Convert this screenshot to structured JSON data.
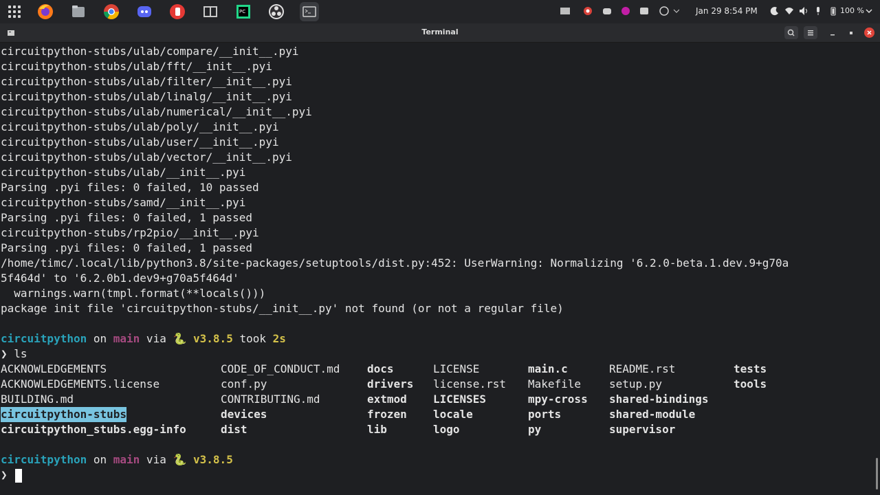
{
  "panel": {
    "apps": [
      "app-grid",
      "firefox",
      "files",
      "chrome",
      "discord",
      "stack-app",
      "system-monitor",
      "pycharm",
      "obs",
      "terminal"
    ],
    "clock": "Jan 29  8:54 PM",
    "battery": "100 %"
  },
  "window": {
    "title": "Terminal"
  },
  "terminal": {
    "output": [
      "circuitpython-stubs/ulab/compare/__init__.pyi",
      "circuitpython-stubs/ulab/fft/__init__.pyi",
      "circuitpython-stubs/ulab/filter/__init__.pyi",
      "circuitpython-stubs/ulab/linalg/__init__.pyi",
      "circuitpython-stubs/ulab/numerical/__init__.pyi",
      "circuitpython-stubs/ulab/poly/__init__.pyi",
      "circuitpython-stubs/ulab/user/__init__.pyi",
      "circuitpython-stubs/ulab/vector/__init__.pyi",
      "circuitpython-stubs/ulab/__init__.pyi",
      "Parsing .pyi files: 0 failed, 10 passed",
      "circuitpython-stubs/samd/__init__.pyi",
      "Parsing .pyi files: 0 failed, 1 passed",
      "circuitpython-stubs/rp2pio/__init__.pyi",
      "Parsing .pyi files: 0 failed, 1 passed",
      "/home/timc/.local/lib/python3.8/site-packages/setuptools/dist.py:452: UserWarning: Normalizing '6.2.0-beta.1.dev.9+g70a",
      "5f464d' to '6.2.0b1.dev9+g70a5f464d'",
      "  warnings.warn(tmpl.format(**locals()))",
      "package init file 'circuitpython-stubs/__init__.py' not found (or not a regular file)"
    ],
    "prompt1": {
      "dir": "circuitpython",
      "on": " on ",
      "branch_icon": "",
      "branch": "main",
      "via": " via ",
      "py_icon": "🐍",
      "version": " v3.8.5",
      "took": " took ",
      "dur": "2s"
    },
    "command": "❯ ls",
    "ls": {
      "col1": [
        "ACKNOWLEDGEMENTS",
        "ACKNOWLEDGEMENTS.license",
        "BUILDING.md",
        "circuitpython-stubs",
        "circuitpython_stubs.egg-info"
      ],
      "col2": [
        "CODE_OF_CONDUCT.md",
        "conf.py",
        "CONTRIBUTING.md",
        "devices",
        "dist"
      ],
      "col3": [
        "docs",
        "drivers",
        "extmod",
        "frozen",
        "lib"
      ],
      "col4": [
        "LICENSE",
        "license.rst",
        "LICENSES",
        "locale",
        "logo"
      ],
      "col5": [
        "main.c",
        "Makefile",
        "mpy-cross",
        "ports",
        "py"
      ],
      "col6": [
        "README.rst",
        "setup.py",
        "shared-bindings",
        "shared-module",
        "supervisor"
      ],
      "col7": [
        "tests",
        "tools"
      ]
    },
    "prompt2": {
      "dir": "circuitpython",
      "on": " on ",
      "branch_icon": "",
      "branch": "main",
      "via": " via ",
      "py_icon": "🐍",
      "version": " v3.8.5"
    },
    "prompt_symbol": "❯"
  }
}
